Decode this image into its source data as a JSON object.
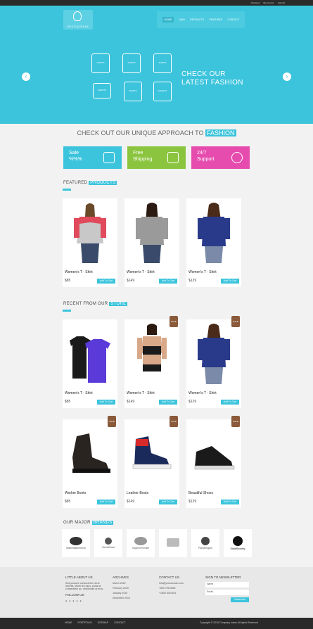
{
  "topbar": {
    "links": [
      "Checkout",
      "My Account",
      "Cart (0)"
    ]
  },
  "logo": {
    "text": "BOUTIQUEKAE"
  },
  "nav": {
    "items": [
      "HOME",
      "MAN",
      "PRODUCTS",
      "FEATURES",
      "CONTACT"
    ]
  },
  "hero": {
    "tagline_line1": "CHECK OUR",
    "tagline_line2": "LATEST FASHION",
    "garment_labels": [
      "SHIRTS",
      "SHIRTS",
      "SHIRTS",
      "SHORTS",
      "SHIRTS",
      "SHORTS"
    ],
    "prev_arrow": "‹",
    "next_arrow": "›"
  },
  "approach": {
    "text": "CHECK OUT OUR UNIQUE APPROACH TO",
    "highlight": "FASHION"
  },
  "features": [
    {
      "line1": "Sale",
      "line2": "%%%",
      "color": "#3cc4dc"
    },
    {
      "line1": "Free",
      "line2": "Shipping",
      "color": "#8bc53f"
    },
    {
      "line1": "24/7",
      "line2": "Support",
      "color": "#e64cae"
    }
  ],
  "featured": {
    "title": "FEATURED",
    "highlight": "PRODUCTS",
    "products": [
      {
        "name": "Women's T - Shirt",
        "price": "$85",
        "cart": "Add To Cart"
      },
      {
        "name": "Women's T - Shirt",
        "price": "$149",
        "cart": "Add To Cart"
      },
      {
        "name": "Women's T - Shirt",
        "price": "$129",
        "cart": "Add To Cart"
      }
    ]
  },
  "recent": {
    "title": "RECENT FROM OUR",
    "highlight": "STORE",
    "badge": "SALE",
    "products": [
      {
        "name": "Women's T - Shirt",
        "price": "$85",
        "cart": "Add To Cart"
      },
      {
        "name": "Women's T - Shirt",
        "price": "$149",
        "cart": "Add To Cart"
      },
      {
        "name": "Women's T - Shirt",
        "price": "$129",
        "cart": "Add To Cart"
      },
      {
        "name": "Worker Boots",
        "price": "$85",
        "cart": "Add To Cart"
      },
      {
        "name": "Leather Boots",
        "price": "$149",
        "cart": "Add To Cart"
      },
      {
        "name": "Beautiful Shoes",
        "price": "$129",
        "cart": "Add To Cart"
      }
    ]
  },
  "brands": {
    "title": "OUR MAJOR",
    "highlight": "BRANDS",
    "items": [
      "WaterWatermelon",
      "HarrisRoad",
      "InspiredFemale",
      "",
      "ParisElegant",
      "SolidSociety"
    ]
  },
  "footer": {
    "about_title": "LITTLE ABOUT US",
    "about_text": "Sed posuere consectetur est at lobortis. Morbi leo risus, porta ac consectetur ac, vestibulum at eros.",
    "follow_title": "FOLLOW US",
    "archives_title": "ARCHIVES",
    "archives": [
      "March 2015",
      "February 2015",
      "January 2015",
      "December 2014"
    ],
    "contact_title": "CONTACT US",
    "contact": [
      "info@yourdomain.com",
      "+800 756 3456",
      "+1800 6007541"
    ],
    "newsletter_title": "SIGN TO NEWSLETTER",
    "newsletter_name": "Name",
    "newsletter_email": "Email",
    "newsletter_button": "Subscribe"
  },
  "bottombar": {
    "links": [
      "HOME",
      "PORTFOLIO",
      "SITEMAP",
      "CONTACT"
    ],
    "copyright": "Copyright © 2015 Company name All rights Reserved"
  }
}
